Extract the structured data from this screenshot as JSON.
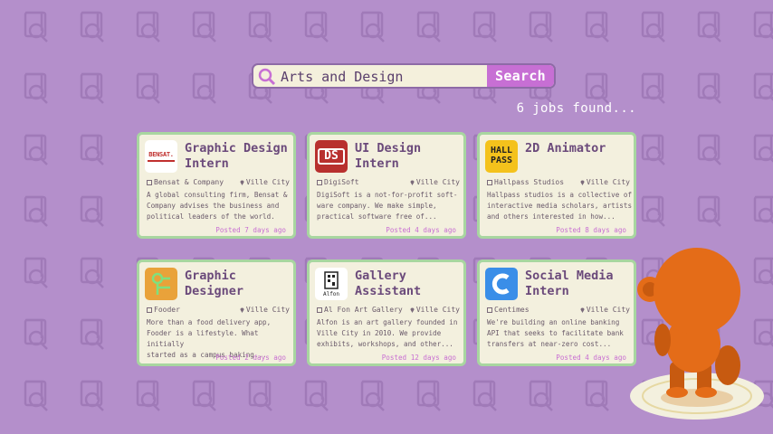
{
  "search": {
    "value": "Arts and Design",
    "button_label": "Search"
  },
  "results_count": "6 jobs found...",
  "jobs": [
    {
      "title_line1": "Graphic Design",
      "title_line2": "Intern",
      "company": "Bensat & Company",
      "location": "Ville City",
      "desc": [
        "A global consulting firm, Bensat &",
        "Company advises the business and",
        "political leaders of the world."
      ],
      "posted": "Posted 7 days ago",
      "logo_text": "BENSAT.",
      "logo_color": "#ffffff"
    },
    {
      "title_line1": "UI Design",
      "title_line2": "Intern",
      "company": "DigiSoft",
      "location": "Ville City",
      "desc": [
        "DigiSoft is a not-for-profit soft-",
        "ware company. We make simple,",
        "practical software free of..."
      ],
      "posted": "Posted 4 days ago",
      "logo_text": "DS",
      "logo_color": "#b8302e"
    },
    {
      "title_line1": "2D Animator",
      "title_line2": "",
      "company": "Hallpass Studios",
      "location": "Ville City",
      "desc": [
        "Hallpass studios is a collective of",
        "interactive media scholars, artists",
        "and others interested in how..."
      ],
      "posted": "Posted 8 days ago",
      "logo_text_1": "HALL",
      "logo_text_2": "PASS",
      "logo_color": "#f4c21c"
    },
    {
      "title_line1": "Graphic",
      "title_line2": "Designer",
      "company": "Fooder",
      "location": "Ville City",
      "desc": [
        "More than a food delivery app,",
        "Fooder is a lifestyle. What initially",
        "started as a campus baking..."
      ],
      "posted": "Posted 2 days ago",
      "logo_color": "#e9a23a"
    },
    {
      "title_line1": "Gallery",
      "title_line2": "Assistant",
      "company": "Al Fon Art Gallery",
      "location": "Ville City",
      "desc": [
        "Alfon is an art gallery founded in",
        "Ville City in 2010. We provide",
        "exhibits, workshops, and other..."
      ],
      "posted": "Posted 12 days ago",
      "logo_text": "Alfon",
      "logo_color": "#ffffff"
    },
    {
      "title_line1": "Social Media",
      "title_line2": "Intern",
      "company": "Centimes",
      "location": "Ville City",
      "desc": [
        "We're building an online banking",
        "API that seeks to facilitate bank",
        "transfers at near-zero cost..."
      ],
      "posted": "Posted 4 days ago",
      "logo_color": "#3a8ee8"
    }
  ],
  "colors": {
    "background": "#b48fcb",
    "accent": "#c76fd4",
    "card_border": "#a8d6a0",
    "card_bg": "#f3f0de"
  }
}
